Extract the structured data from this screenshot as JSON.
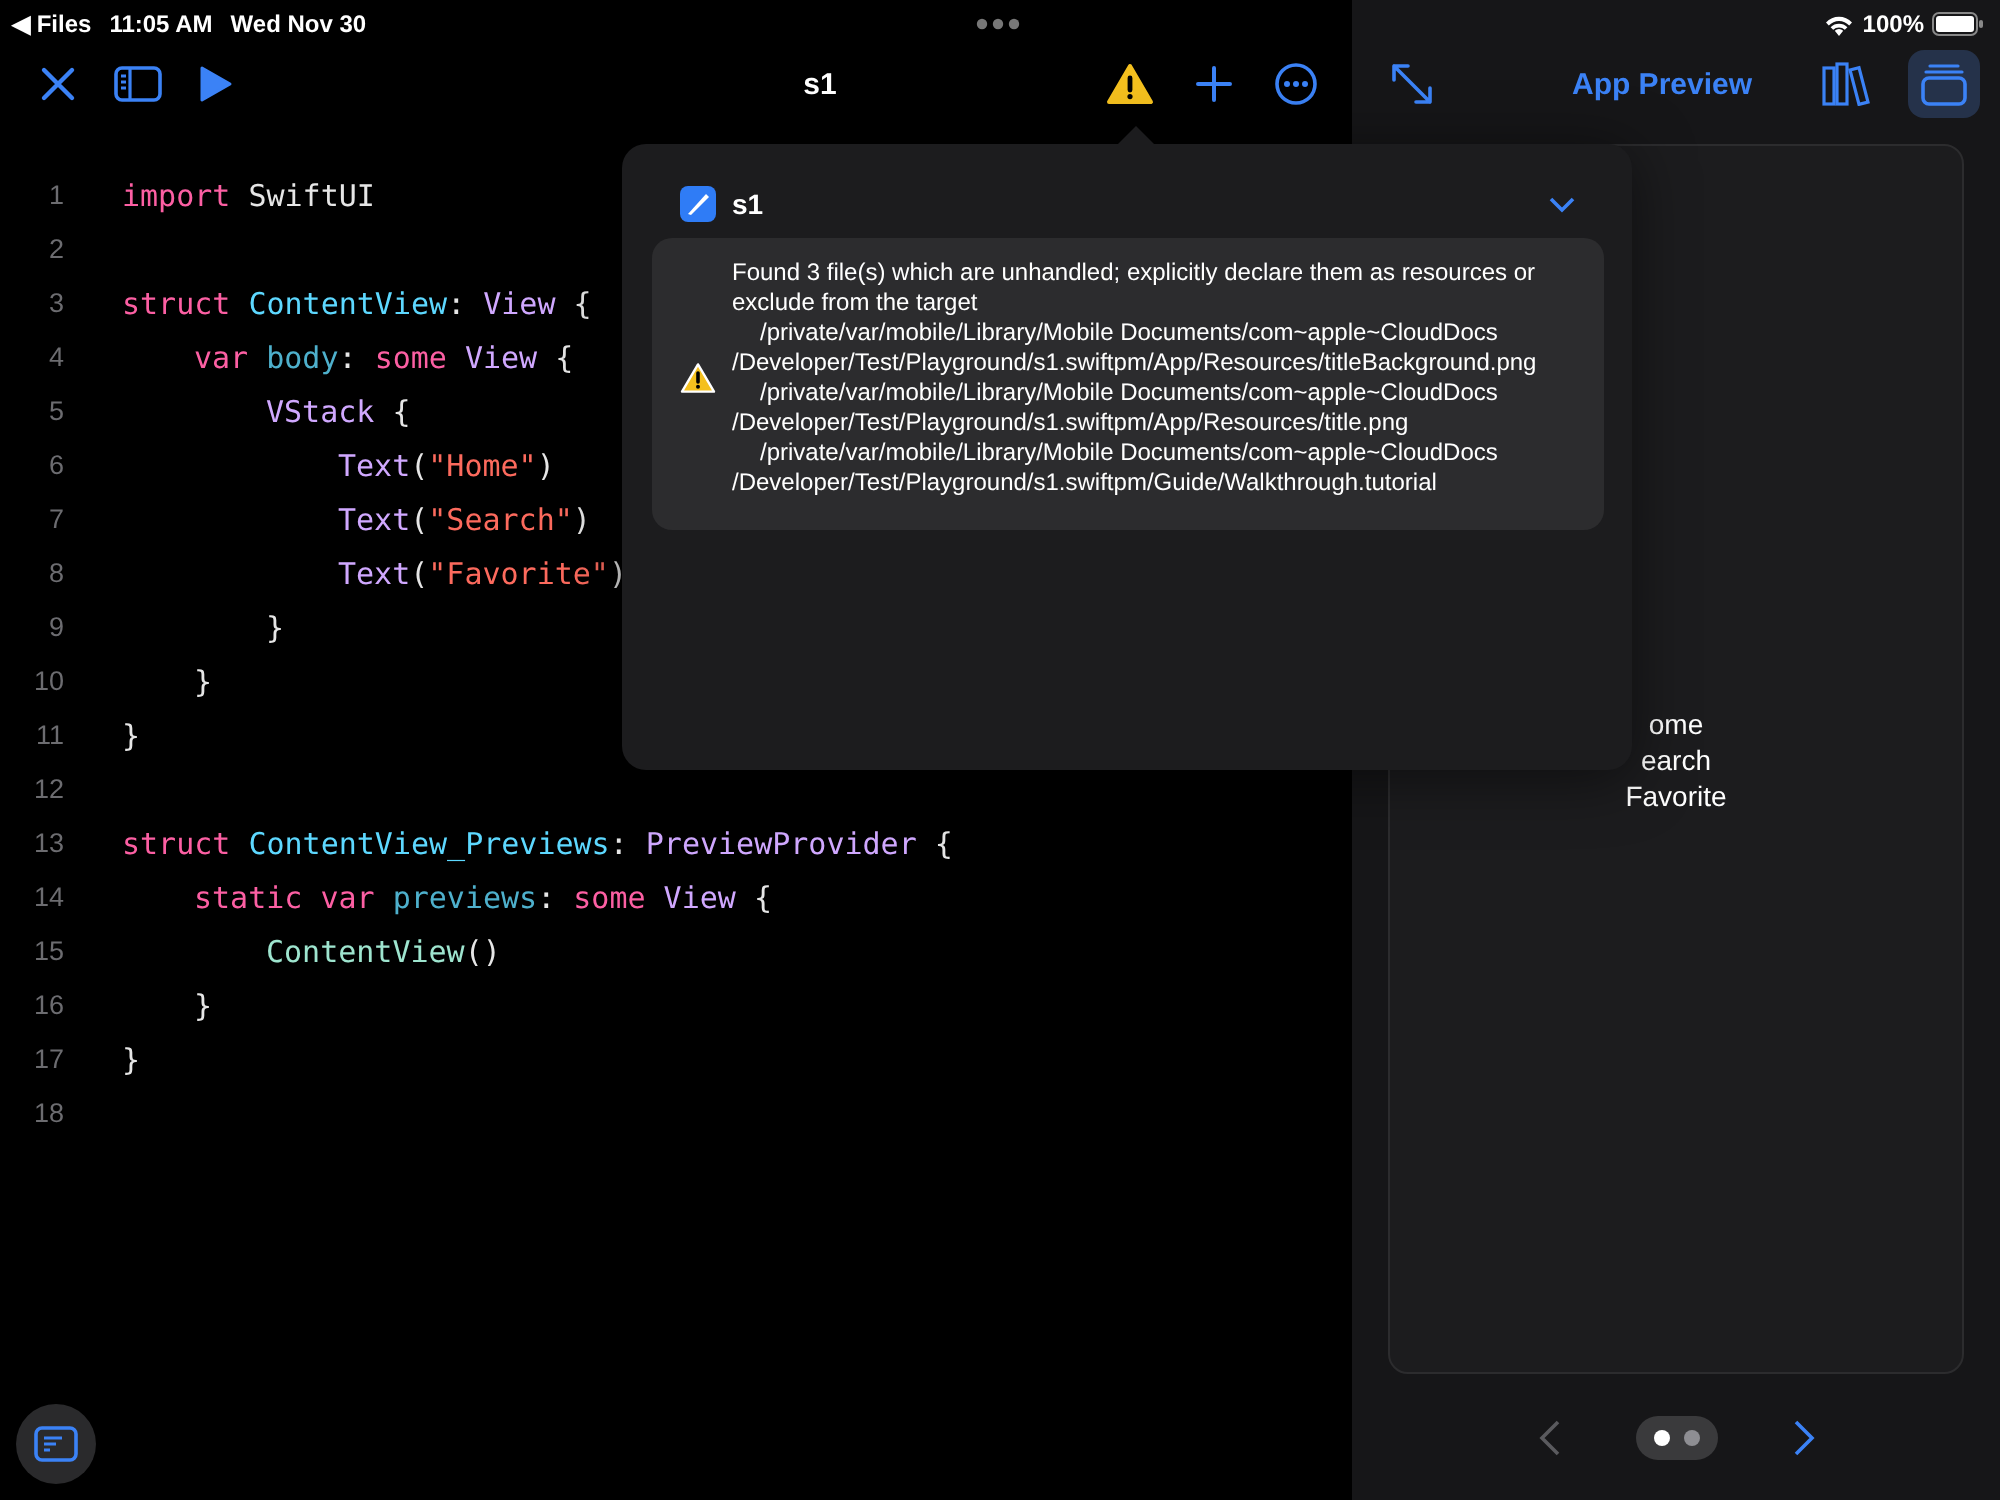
{
  "status_bar": {
    "back_arrow": "◀",
    "back_label": "Files",
    "time": "11:05 AM",
    "date": "Wed Nov 30",
    "battery": "100%"
  },
  "toolbar": {
    "title": "s1"
  },
  "preview_toolbar": {
    "title": "App Preview",
    "modes": [
      {
        "kind": "library",
        "selected": false
      },
      {
        "kind": "windows",
        "selected": true
      }
    ]
  },
  "editor": {
    "lines": [
      {
        "number": "1",
        "tokens": [
          {
            "kind": "keyword",
            "text": "import"
          },
          {
            "kind": "plain",
            "text": " SwiftUI"
          }
        ]
      },
      {
        "number": "2"
      },
      {
        "number": "3",
        "tokens": [
          {
            "kind": "keyword",
            "text": "struct"
          },
          {
            "kind": "decl",
            "text": " ContentView"
          },
          {
            "kind": "plain",
            "text": ": "
          },
          {
            "kind": "type",
            "text": "View"
          },
          {
            "kind": "plain",
            "text": " {"
          }
        ],
        "children": [
          {
            "number": "4",
            "tokens": [
              {
                "kind": "keyword",
                "text": "var"
              },
              {
                "kind": "property",
                "text": " body"
              },
              {
                "kind": "plain",
                "text": ": "
              },
              {
                "kind": "keyword",
                "text": "some"
              },
              {
                "kind": "type",
                "text": " View"
              },
              {
                "kind": "plain",
                "text": " {"
              }
            ],
            "children": [
              {
                "number": "5",
                "tokens": [
                  {
                    "kind": "type",
                    "text": "VStack"
                  },
                  {
                    "kind": "plain",
                    "text": " {"
                  }
                ],
                "children": [
                  {
                    "number": "6",
                    "tokens": [
                      {
                        "kind": "type",
                        "text": "Text"
                      },
                      {
                        "kind": "plain",
                        "text": "("
                      },
                      {
                        "kind": "string",
                        "text": "\"Home\""
                      },
                      {
                        "kind": "plain",
                        "text": ")"
                      }
                    ]
                  },
                  {
                    "number": "7",
                    "tokens": [
                      {
                        "kind": "type",
                        "text": "Text"
                      },
                      {
                        "kind": "plain",
                        "text": "("
                      },
                      {
                        "kind": "string",
                        "text": "\"Search\""
                      },
                      {
                        "kind": "plain",
                        "text": ")"
                      }
                    ]
                  },
                  {
                    "number": "8",
                    "tokens": [
                      {
                        "kind": "type",
                        "text": "Text"
                      },
                      {
                        "kind": "plain",
                        "text": "("
                      },
                      {
                        "kind": "string",
                        "text": "\"Favorite\""
                      },
                      {
                        "kind": "plain",
                        "text": ")"
                      }
                    ]
                  }
                ]
              },
              {
                "number": "9",
                "tokens": [
                  {
                    "kind": "plain",
                    "text": "}"
                  }
                ]
              }
            ]
          },
          {
            "number": "10",
            "tokens": [
              {
                "kind": "plain",
                "text": "}"
              }
            ]
          }
        ]
      },
      {
        "number": "11",
        "tokens": [
          {
            "kind": "plain",
            "text": "}"
          }
        ]
      },
      {
        "number": "12"
      },
      {
        "number": "13",
        "tokens": [
          {
            "kind": "keyword",
            "text": "struct"
          },
          {
            "kind": "decl",
            "text": " ContentView_Previews"
          },
          {
            "kind": "plain",
            "text": ": "
          },
          {
            "kind": "type",
            "text": "PreviewProvider"
          },
          {
            "kind": "plain",
            "text": " {"
          }
        ],
        "children": [
          {
            "number": "14",
            "tokens": [
              {
                "kind": "keyword",
                "text": "static"
              },
              {
                "kind": "keyword",
                "text": " var"
              },
              {
                "kind": "property",
                "text": " previews"
              },
              {
                "kind": "plain",
                "text": ": "
              },
              {
                "kind": "keyword",
                "text": "some"
              },
              {
                "kind": "type",
                "text": " View"
              },
              {
                "kind": "plain",
                "text": " {"
              }
            ],
            "children": [
              {
                "number": "15",
                "tokens": [
                  {
                    "kind": "call",
                    "text": "ContentView"
                  },
                  {
                    "kind": "plain",
                    "text": "()"
                  }
                ]
              }
            ]
          },
          {
            "number": "16",
            "tokens": [
              {
                "kind": "plain",
                "text": "}"
              }
            ]
          }
        ]
      },
      {
        "number": "17",
        "tokens": [
          {
            "kind": "plain",
            "text": "}"
          }
        ]
      },
      {
        "number": "18"
      }
    ]
  },
  "popover": {
    "target": "s1",
    "message": "Found 3 file(s) which are unhandled; explicitly declare them as resources or exclude from the target",
    "paths": [
      "/private/var/mobile/Library/Mobile Documents/com~apple~CloudDocs/Developer/Test/Playground/s1.swiftpm/App/Resources/titleBackground.png",
      "/private/var/mobile/Library/Mobile Documents/com~apple~CloudDocs/Developer/Test/Playground/s1.swiftpm/App/Resources/title.png",
      "/private/var/mobile/Library/Mobile Documents/com~apple~CloudDocs/Developer/Test/Playground/s1.swiftpm/Guide/Walkthrough.tutorial"
    ]
  },
  "preview": {
    "texts": [
      "ome",
      "earch",
      "Favorite"
    ]
  },
  "pager": {
    "previous_disabled": true,
    "next_disabled": false,
    "pages": [
      {
        "selected": true
      },
      {
        "selected": false
      }
    ]
  }
}
